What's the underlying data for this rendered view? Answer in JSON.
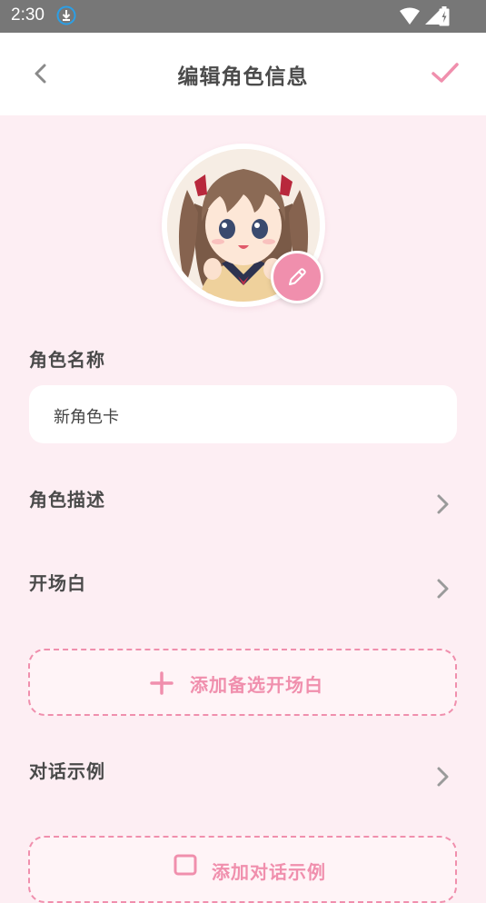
{
  "status_bar": {
    "time": "2:30"
  },
  "header": {
    "title": "编辑角色信息"
  },
  "name_section": {
    "label": "角色名称",
    "value": "新角色卡"
  },
  "rows": [
    {
      "label": "角色描述"
    },
    {
      "label": "开场白"
    },
    {
      "label": "对话示例"
    }
  ],
  "add_greeting": {
    "label": "添加备选开场白"
  },
  "add_example": {
    "label": "添加对话示例"
  },
  "colors": {
    "accent": "#f08fad",
    "background": "#fdeef3",
    "status_bar": "#777777"
  }
}
